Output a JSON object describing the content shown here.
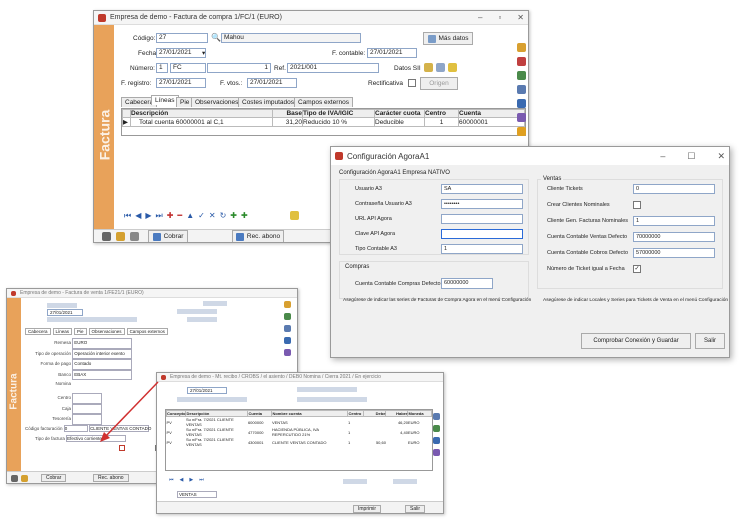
{
  "main": {
    "title": "Empresa de demo - Factura de compra 1/FC/1 (EURO)",
    "labels": {
      "codigo": "Código:",
      "fecha": "Fecha:",
      "numero": "Número:",
      "fregistro": "F. registro:",
      "fcontable": "F. contable:",
      "ref": "Ref.",
      "fvtos": "F. vtos.:",
      "datos_sii": "Datos SII",
      "rectificativa": "Rectificativa"
    },
    "values": {
      "codigo": "27",
      "proveedor": "Mahou",
      "fecha": "27/01/2021",
      "numero": "1",
      "serie": "FC",
      "num2": "1",
      "ref": "2021/001",
      "fregistro": "27/01/2021",
      "fvtos": "27/01/2021",
      "fcontable": "27/01/2021"
    },
    "buttons": {
      "mas_datos": "Más datos",
      "origen": "Origen",
      "cobrar": "Cobrar",
      "rec_abono": "Rec. abono"
    },
    "tabs": [
      "Cabecera",
      "Líneas",
      "Pie",
      "Observaciones",
      "Costes imputados",
      "Campos externos"
    ],
    "table": {
      "headers": [
        "Descripción",
        "Base",
        "Tipo de IVA/IGIC",
        "Carácter cuota",
        "Centro",
        "Cuenta"
      ],
      "rows": [
        [
          "Total cuenta 60000001 al C,1",
          "31,20",
          "Reducido 10 %",
          "Deducible",
          "1",
          "60000001"
        ]
      ]
    },
    "side_label": "Factura"
  },
  "config": {
    "title": "Configuración AgoraA1",
    "subtitle": "Configuración AgoraA1 Empresa NATIVO",
    "left": [
      {
        "label": "Usuario A3",
        "value": "SA"
      },
      {
        "label": "Contraseña Usuario A3",
        "value": "••••••••"
      },
      {
        "label": "URL API Agora",
        "value": ""
      },
      {
        "label": "Clave API Agora",
        "value": ""
      },
      {
        "label": "Tipo Contable A3",
        "value": "1"
      }
    ],
    "compras_label": "Compras",
    "compras_field": {
      "label": "Cuenta Contable Compras Defecto",
      "value": "60000000"
    },
    "note_left": "Asegúrese de indicar las series de Facturas de Compra Agora en el menú Configuración",
    "ventas_label": "Ventas",
    "right": [
      {
        "label": "Cliente Tickets",
        "value": "0",
        "type": "text"
      },
      {
        "label": "Crear Clientes Nominales",
        "value": "",
        "type": "check"
      },
      {
        "label": "Cliente Gen. Facturas Nominales",
        "value": "1",
        "type": "text"
      },
      {
        "label": "Cuenta Contable Ventas Defecto",
        "value": "70000000",
        "type": "text"
      },
      {
        "label": "Cuenta Contable Cobros Defecto",
        "value": "57000000",
        "type": "text"
      },
      {
        "label": "Número de Ticket igual a Fecha",
        "value": "",
        "type": "checked"
      }
    ],
    "note_right": "Asegúrese de indicar Locales y Series para Tickets de Venta en el menú Configuración",
    "btn_check": "Comprobar Conexión y Guardar",
    "btn_exit": "Salir"
  },
  "small1": {
    "title": "Empresa de demo - Factura de venta 1/FE21/1 (EURO)",
    "tabs": [
      "Cabecera",
      "Líneas",
      "Pie",
      "Observaciones",
      "Campos externos"
    ],
    "rows": [
      "Remesa",
      "Tipo de operación",
      "Forma de pago",
      "Banco",
      "Nomina",
      "Centro",
      "Caja",
      "Tesorería",
      "Código facturación",
      "Tipo de factura"
    ],
    "vals": [
      "EURO",
      "Operación interior exento",
      "Contado",
      "EBAX",
      "",
      "",
      "",
      "",
      "0",
      "Efectivo corriente"
    ],
    "f_fecha": "27/01/2021",
    "cliente": "CLIENTE VENTAS CONTADO",
    "side_label": "Factura",
    "cobrar": "Cobrar",
    "rec_abono": "Rec. abono"
  },
  "small2": {
    "title": "Empresa de demo - Mt. recibo / CROBS / el asiento / DEB0 Nomina / Cierra 2021 / En ejercicio",
    "fecha": "27/01/2021",
    "headers": [
      "Concepto",
      "Descripción",
      "Cuenta",
      "Nombre cuenta",
      "Centro",
      "Debe",
      "Haber",
      "Moneda"
    ],
    "rows": [
      [
        "PV",
        "Su n/Fra. 7/2021 CLIENTE VENTAS",
        "6000000",
        "VENTAS",
        "1",
        "",
        "46,20",
        "EURO"
      ],
      [
        "PV",
        "Su n/Fra. 7/2021 CLIENTE VENTAS",
        "4770000",
        "HACIENDA PÚBLICA, IVA REPERCUTIDO 21%",
        "1",
        "",
        "4,40",
        "EURO"
      ],
      [
        "PV",
        "Su n/Fra. 7/2021 CLIENTE VENTAS",
        "4300001",
        "CLIENTE VENTAS CONTADO",
        "1",
        "50,60",
        "",
        "EURO"
      ]
    ],
    "cuenta": "VENTAS",
    "imprimir": "Imprimir",
    "salir": "Salir"
  }
}
